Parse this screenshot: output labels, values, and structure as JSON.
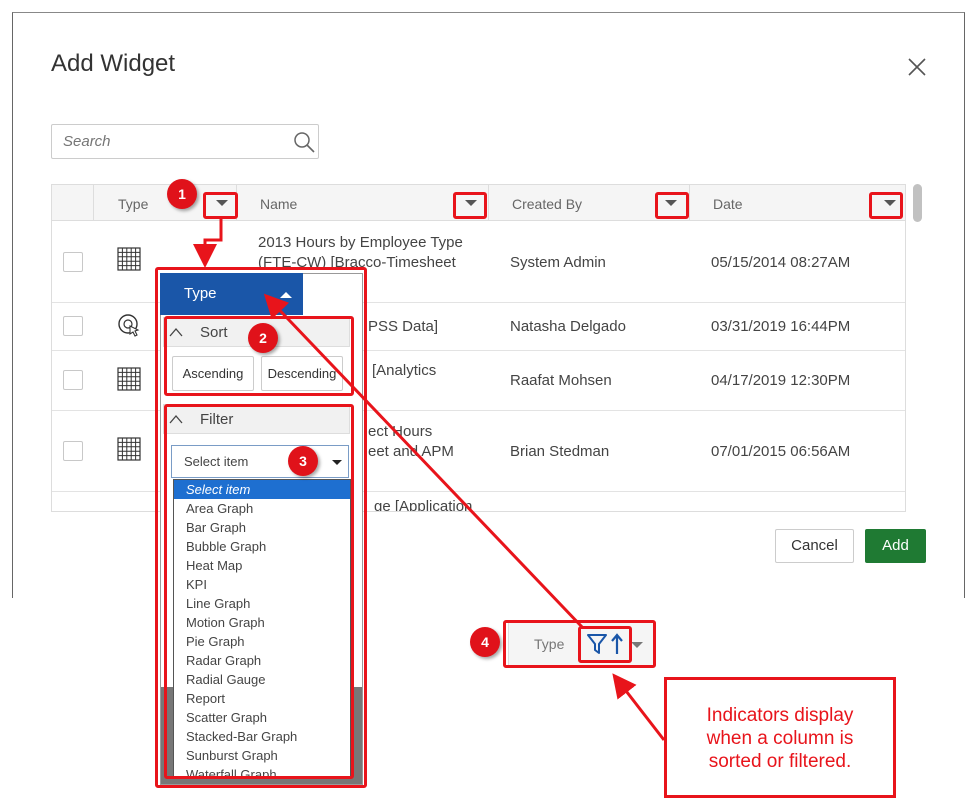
{
  "dialog": {
    "title": "Add Widget",
    "search_placeholder": "Search",
    "cancel_label": "Cancel",
    "add_label": "Add"
  },
  "grid": {
    "columns": [
      "Type",
      "Name",
      "Created By",
      "Date"
    ],
    "rows": [
      {
        "icon": "grid-table-icon",
        "name_line1": "2013 Hours by Employee Type",
        "name_line2": "(FTE-CW) [Bracco-Timesheet",
        "created_by": "System Admin",
        "date": "05/15/2014 08:27AM"
      },
      {
        "icon": "radial-gauge-icon",
        "name_line1": "PSS Data]",
        "name_line2": "",
        "created_by": "Natasha Delgado",
        "date": "03/31/2019 16:44PM"
      },
      {
        "icon": "grid-table-icon",
        "name_line1": "[Analytics",
        "name_line2": "",
        "created_by": "Raafat Mohsen",
        "date": "04/17/2019 12:30PM"
      },
      {
        "icon": "grid-table-icon",
        "name_line1": "ect Hours",
        "name_line2": "eet and APM",
        "created_by": "Brian Stedman",
        "date": "07/01/2015 06:56AM"
      },
      {
        "icon": "",
        "name_line1": "ge [Application",
        "name_line2": "",
        "created_by": "",
        "date": ""
      }
    ]
  },
  "dropdown": {
    "tab_label": "Type",
    "sort_label": "Sort",
    "ascending_label": "Ascending",
    "descending_label": "Descending",
    "filter_label": "Filter",
    "select_placeholder": "Select item",
    "options": [
      "Select item",
      "Area Graph",
      "Bar Graph",
      "Bubble Graph",
      "Heat Map",
      "KPI",
      "Line Graph",
      "Motion Graph",
      "Pie Graph",
      "Radar Graph",
      "Radial Gauge",
      "Report",
      "Scatter Graph",
      "Stacked-Bar Graph",
      "Sunburst Graph",
      "Waterfall Graph"
    ],
    "selected_option": "Select item"
  },
  "indicator_sample": {
    "label": "Type",
    "icons": [
      "filter-icon",
      "sort-ascending-icon"
    ]
  },
  "annotations": {
    "badges": [
      "1",
      "2",
      "3",
      "4"
    ],
    "callout_line1": "Indicators display",
    "callout_line2": "when a column is",
    "callout_line3": "sorted or filtered.",
    "color": "#e8141b"
  },
  "colors": {
    "primary_blue": "#1a56a8",
    "add_green": "#1f7a33",
    "selection_blue": "#1e6fd0"
  }
}
